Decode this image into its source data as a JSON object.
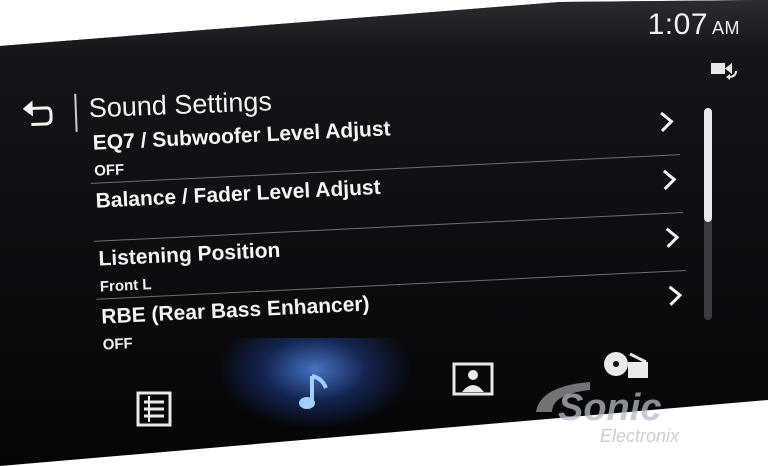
{
  "status": {
    "time": "1:07",
    "ampm": "AM"
  },
  "header": {
    "title": "Sound Settings",
    "back_icon": "back-arrow-icon"
  },
  "menu": {
    "items": [
      {
        "label": "EQ7 / Subwoofer Level Adjust",
        "value": "OFF"
      },
      {
        "label": "Balance / Fader Level Adjust",
        "value": ""
      },
      {
        "label": "Listening Position",
        "value": "Front L"
      },
      {
        "label": "RBE (Rear Bass Enhancer)",
        "value": "OFF"
      }
    ]
  },
  "scroll": {
    "position_fraction": 0.0,
    "visible_fraction": 0.54
  },
  "tabs": [
    {
      "icon": "list-icon",
      "active": false
    },
    {
      "icon": "music-note-icon",
      "active": true
    },
    {
      "icon": "display-image-icon",
      "active": false
    },
    {
      "icon": "disc-settings-icon",
      "active": false
    }
  ],
  "watermark": {
    "brand": "Sonic",
    "sub": "Electronix"
  },
  "colors": {
    "accent": "#4d8cff",
    "text": "#f5f5f5",
    "divider": "#6b6e74"
  }
}
